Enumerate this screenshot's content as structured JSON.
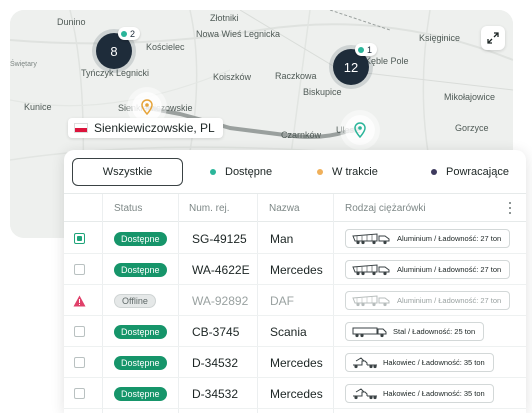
{
  "map": {
    "places": [
      {
        "name": "Dunino"
      },
      {
        "name": "Złotniki"
      },
      {
        "name": "Nowa Wieś Legnicka"
      },
      {
        "name": "Kościelec"
      },
      {
        "name": "Tyńczyk Legnicki"
      },
      {
        "name": "Koiszków"
      },
      {
        "name": "Raczkowa"
      },
      {
        "name": "Księginice"
      },
      {
        "name": "Kęble Pole"
      },
      {
        "name": "Biskupice"
      },
      {
        "name": "Mikołajowice"
      },
      {
        "name": "Czarnków"
      },
      {
        "name": "Ulesie"
      },
      {
        "name": "Sienkiewiczowskie"
      },
      {
        "name": "Świętary"
      },
      {
        "name": "Kunice"
      },
      {
        "name": "Gorzyce"
      }
    ],
    "clusters": [
      {
        "count": "8",
        "badge": "2"
      },
      {
        "count": "12",
        "badge": "1"
      }
    ],
    "location_label": "Sienkiewiczowskie, PL",
    "expand_icon": "expand-icon",
    "colors": {
      "route": "#9aa09e",
      "cluster": "#1e2c3a",
      "pin_orange": "#e6a43a",
      "pin_teal": "#2bb59a"
    }
  },
  "filters": {
    "all": "Wszystkie",
    "items": [
      {
        "label": "Dostępne",
        "color": "#2bb59a"
      },
      {
        "label": "W trakcie",
        "color": "#f0b05a"
      },
      {
        "label": "Powracające",
        "color": "#3e3a5e"
      }
    ]
  },
  "table": {
    "columns": [
      "Status",
      "Num. rej.",
      "Nazwa",
      "Rodzaj ciężarówki"
    ],
    "rows": [
      {
        "status": "Dostępne",
        "reg": "SG-49125",
        "name": "Man",
        "type": "Aluminium / Ładowność: 27 ton",
        "checked": true,
        "alert": false,
        "offline": false
      },
      {
        "status": "Dostępne",
        "reg": "WA-4622E",
        "name": "Mercedes",
        "type": "Aluminium / Ładowność: 27 ton",
        "checked": false,
        "alert": false,
        "offline": false
      },
      {
        "status": "Offline",
        "reg": "WA-92892",
        "name": "DAF",
        "type": "Aluminium / Ładowność: 27 ton",
        "checked": false,
        "alert": true,
        "offline": true
      },
      {
        "status": "Dostępne",
        "reg": "CB-3745",
        "name": "Scania",
        "type": "Stal / Ładowność: 25 ton",
        "checked": false,
        "alert": false,
        "offline": false
      },
      {
        "status": "Dostępne",
        "reg": "D-34532",
        "name": "Mercedes",
        "type": "Hakowiec / Ładowność: 35 ton",
        "checked": false,
        "alert": false,
        "offline": false
      },
      {
        "status": "Dostępne",
        "reg": "D-34532",
        "name": "Mercedes",
        "type": "Hakowiec / Ładowność: 35 ton",
        "checked": false,
        "alert": false,
        "offline": false
      }
    ]
  }
}
